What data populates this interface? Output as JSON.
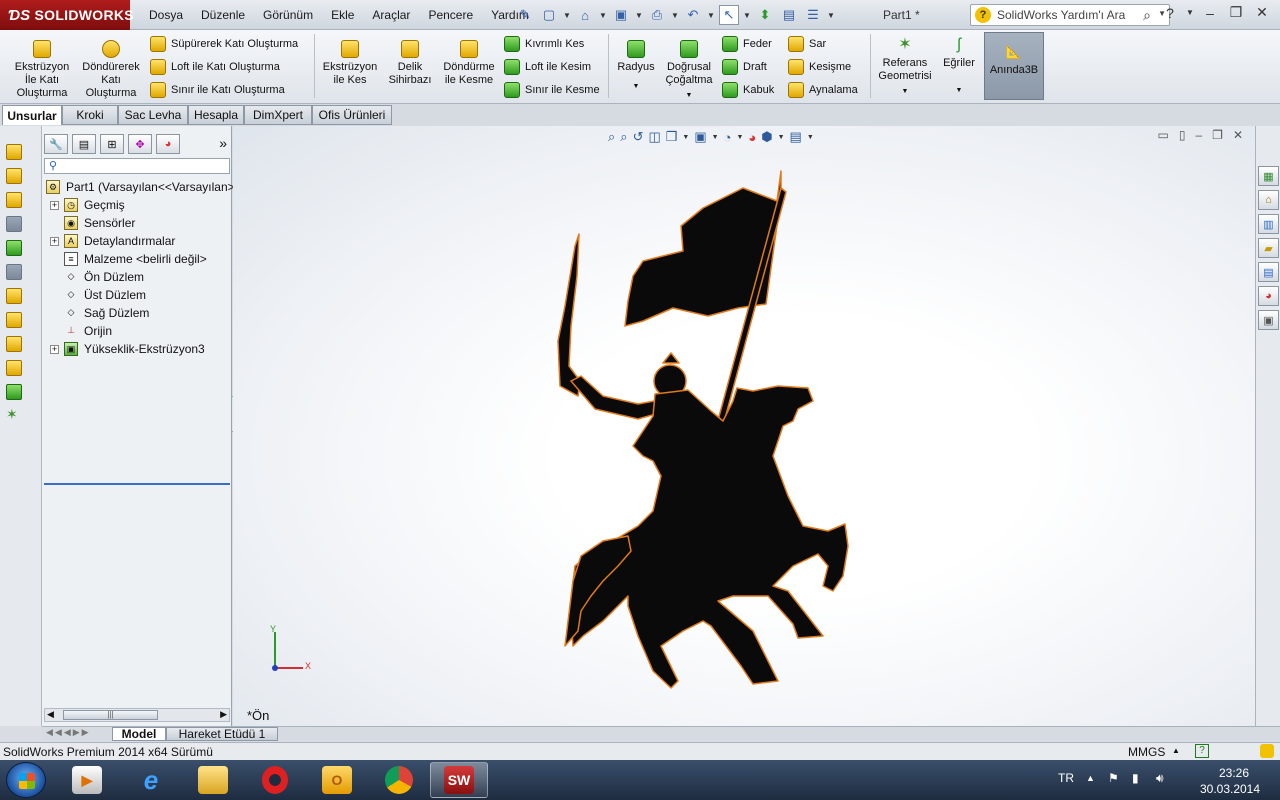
{
  "app": {
    "brand": "SOLIDWORKS",
    "document_title": "Part1 *"
  },
  "menu": [
    "Dosya",
    "Düzenle",
    "Görünüm",
    "Ekle",
    "Araçlar",
    "Pencere",
    "Yardım"
  ],
  "search": {
    "placeholder": "SolidWorks Yardım'ı Ara"
  },
  "ribbon": {
    "extrude_boss": "Ekstrüzyon İle Katı Oluşturma",
    "revolve_boss": "Döndürerek Katı Oluşturma",
    "sweep_boss": "Süpürerek Katı Oluşturma",
    "loft_boss": "Loft ile Katı Oluşturma",
    "boundary_boss": "Sınır ile Katı Oluşturma",
    "extrude_cut": "Ekstrüzyon ile Kes",
    "hole_wizard": "Delik Sihirbazı",
    "revolve_cut": "Döndürme ile Kesme",
    "swept_cut": "Kıvrımlı Kes",
    "loft_cut": "Loft ile Kesim",
    "boundary_cut": "Sınır ile Kesme",
    "fillet": "Radyus",
    "linear_pattern": "Doğrusal Çoğaltma",
    "rib": "Feder",
    "draft": "Draft",
    "shell": "Kabuk",
    "wrap": "Sar",
    "intersect": "Kesişme",
    "mirror": "Aynalama",
    "ref_geometry": "Referans Geometrisi",
    "curves": "Eğriler",
    "instant3d": "Anında3B"
  },
  "tabs": [
    "Unsurlar",
    "Kroki",
    "Sac Levha",
    "Hesapla",
    "DimXpert",
    "Ofis Ürünleri"
  ],
  "tree": {
    "root": "Part1  (Varsayılan<<Varsayılan>",
    "items": [
      "Geçmiş",
      "Sensörler",
      "Detaylandırmalar",
      "Malzeme <belirli değil>",
      "Ön Düzlem",
      "Üst Düzlem",
      "Sağ Düzlem",
      "Orijin",
      "Yükseklik-Ekstrüzyon3"
    ]
  },
  "viewport": {
    "view_name": "*Ön",
    "axis_x": "X",
    "axis_y": "Y"
  },
  "model_tabs": [
    "Model",
    "Hareket Etüdü 1"
  ],
  "status": {
    "product": "SolidWorks Premium 2014 x64 Sürümü",
    "units": "MMGS"
  },
  "taskbar": {
    "language": "TR",
    "time": "23:26",
    "date": "30.03.2014"
  },
  "colors": {
    "brand_red": "#9b1616",
    "silhouette": "#0a0a0a",
    "silhouette_edge": "#e07a1a",
    "active_tab_accent": "#3a6cc8"
  }
}
